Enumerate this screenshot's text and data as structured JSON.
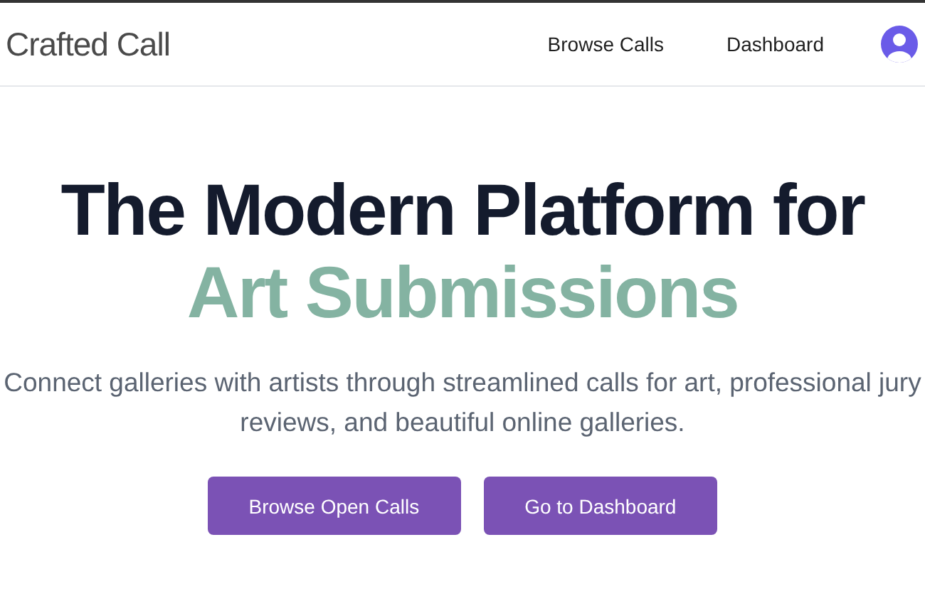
{
  "header": {
    "logo": "Crafted Call",
    "nav": [
      "Browse Calls",
      "Dashboard"
    ]
  },
  "hero": {
    "title_line_1": "The Modern Platform for",
    "title_line_2": "Art Submissions",
    "subtitle": "Connect galleries with artists through streamlined calls for art, professional jury reviews, and beautiful online galleries."
  },
  "buttons": [
    "Browse Open Calls",
    "Go to Dashboard"
  ]
}
